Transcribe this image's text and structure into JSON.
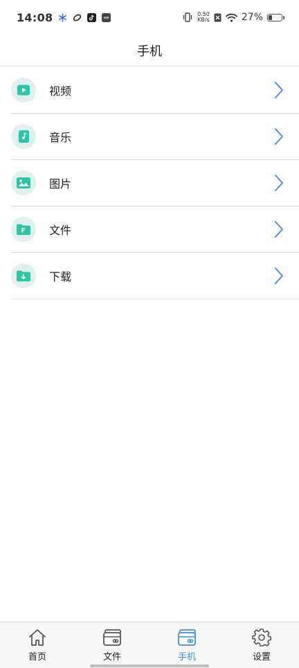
{
  "status_bar": {
    "time": "14:08",
    "net_speed_value": "0.50",
    "net_speed_unit": "KB/s",
    "battery_percent": "27%",
    "battery_level": 0.27
  },
  "header": {
    "title": "手机"
  },
  "list": {
    "items": [
      {
        "label": "视频",
        "icon": "video-icon"
      },
      {
        "label": "音乐",
        "icon": "music-icon"
      },
      {
        "label": "图片",
        "icon": "image-icon"
      },
      {
        "label": "文件",
        "icon": "file-icon"
      },
      {
        "label": "下载",
        "icon": "download-icon"
      }
    ]
  },
  "tabbar": {
    "tabs": [
      {
        "label": "首页",
        "icon": "home-icon",
        "active": false
      },
      {
        "label": "文件",
        "icon": "folder-cards-icon",
        "active": false
      },
      {
        "label": "手机",
        "icon": "phone-storage-icon",
        "active": true
      },
      {
        "label": "设置",
        "icon": "gear-icon",
        "active": false
      }
    ]
  },
  "colors": {
    "accent": "#3b8fd6",
    "icon_green": "#2ec4a5",
    "icon_bg": "#dff1ee",
    "chevron": "#4a90d9"
  }
}
